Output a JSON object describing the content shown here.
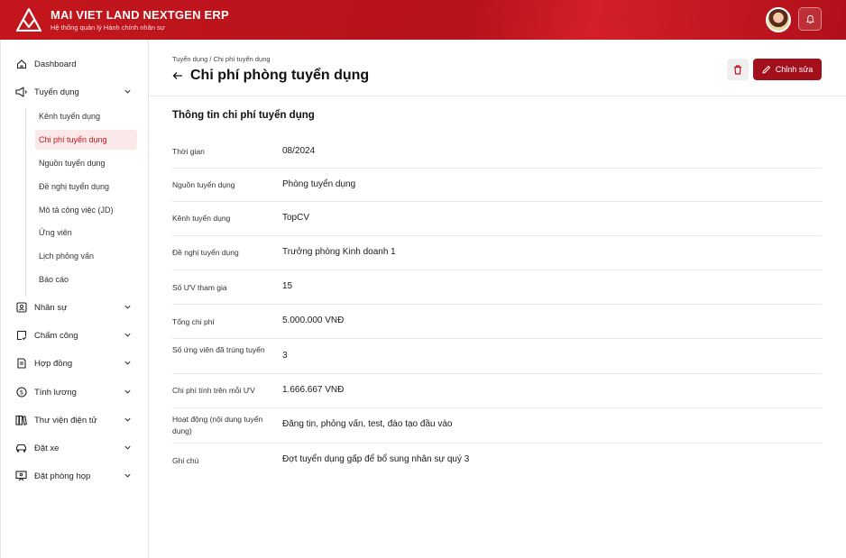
{
  "header": {
    "app_name": "MAI VIET LAND NEXTGEN ERP",
    "app_subtitle": "Hệ thống quản lý Hành chính nhân sự",
    "brand_color": "#c4161c"
  },
  "sidebar": {
    "items": [
      {
        "label": "Dashboard",
        "icon": "home-icon"
      },
      {
        "label": "Tuyển dụng",
        "icon": "megaphone-icon",
        "expanded": true
      },
      {
        "label": "Nhân sự",
        "icon": "id-card-icon"
      },
      {
        "label": "Chấm công",
        "icon": "timesheet-icon"
      },
      {
        "label": "Hợp đồng",
        "icon": "contract-icon"
      },
      {
        "label": "Tính lương",
        "icon": "dollar-icon"
      },
      {
        "label": "Thư viện điện tử",
        "icon": "library-icon"
      },
      {
        "label": "Đặt xe",
        "icon": "car-icon"
      },
      {
        "label": "Đặt phòng họp",
        "icon": "meeting-room-icon"
      }
    ],
    "recruitment_sub": [
      {
        "label": "Kênh tuyển dụng"
      },
      {
        "label": "Chi phí tuyển dụng",
        "active": true
      },
      {
        "label": "Nguồn tuyển dụng"
      },
      {
        "label": "Đề nghị tuyển dụng"
      },
      {
        "label": "Mô tả công việc (JD)"
      },
      {
        "label": "Ứng viên"
      },
      {
        "label": "Lịch phỏng vấn"
      },
      {
        "label": "Báo cáo"
      }
    ]
  },
  "page": {
    "breadcrumb": "Tuyển dụng / Chi phí tuyển dụng",
    "title": "Chi phí phòng tuyển dụng",
    "edit_label": "Chỉnh sửa",
    "section_title": "Thông tin chi phí tuyển dụng"
  },
  "details": [
    {
      "label": "Thời gian",
      "value": "08/2024"
    },
    {
      "label": "Nguồn tuyển dụng",
      "value": "Phòng tuyển dụng"
    },
    {
      "label": "Kênh tuyển dụng",
      "value": "TopCV"
    },
    {
      "label": "Đề nghị tuyển dụng",
      "value": "Trưởng phòng Kinh doanh 1"
    },
    {
      "label": "Số ƯV tham gia",
      "value": "15"
    },
    {
      "label": "Tổng chi phí",
      "value": "5.000.000 VNĐ"
    },
    {
      "label": "Số ứng viên đã trúng tuyển",
      "value": "3"
    },
    {
      "label": "Chi phí tính trên mỗi ƯV",
      "value": "1.666.667 VNĐ"
    },
    {
      "label": "Hoạt động (nội dung tuyển dụng)",
      "value": "Đăng tin, phỏng vấn, test, đào tạo đầu vào"
    },
    {
      "label": "Ghi chú",
      "value": "Đợt tuyển dụng gấp để bổ sung nhân sự quý 3"
    }
  ]
}
